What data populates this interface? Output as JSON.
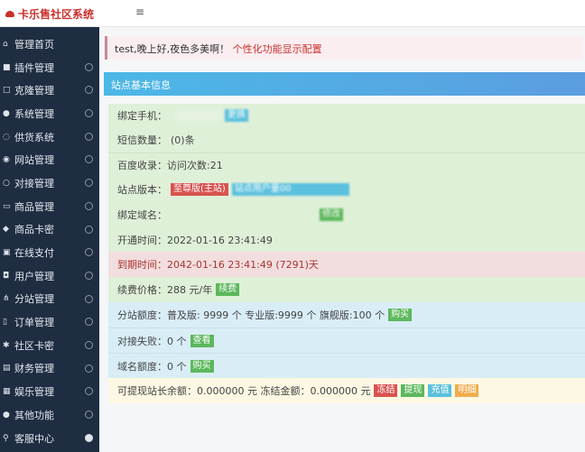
{
  "header": {
    "title": "卡乐售社区系统",
    "menu_icon": "≡"
  },
  "sidebar": {
    "items": [
      {
        "label": "管理首页",
        "icon": "home"
      },
      {
        "label": "插件管理",
        "icon": "lock"
      },
      {
        "label": "克隆管理",
        "icon": "copy"
      },
      {
        "label": "系统管理",
        "icon": "search"
      },
      {
        "label": "供货系统",
        "icon": "supply"
      },
      {
        "label": "网站管理",
        "icon": "globe"
      },
      {
        "label": "对接管理",
        "icon": "link"
      },
      {
        "label": "商品管理",
        "icon": "box"
      },
      {
        "label": "商品卡密",
        "icon": "key"
      },
      {
        "label": "在线支付",
        "icon": "pay"
      },
      {
        "label": "用户管理",
        "icon": "user"
      },
      {
        "label": "分站管理",
        "icon": "share"
      },
      {
        "label": "订单管理",
        "icon": "order"
      },
      {
        "label": "社区卡密",
        "icon": "card"
      },
      {
        "label": "财务管理",
        "icon": "finance"
      },
      {
        "label": "娱乐管理",
        "icon": "game"
      },
      {
        "label": "其他功能",
        "icon": "apple"
      },
      {
        "label": "客服中心",
        "icon": "service"
      }
    ]
  },
  "alert": {
    "greeting": "test,晚上好,夜色多美啊！",
    "link": "个性化功能显示配置"
  },
  "panel": {
    "title": "站点基本信息",
    "phone_label": "绑定手机：",
    "phone_btn": "更换",
    "sms_label": "短信数量：",
    "sms_value": "(0)条",
    "baidu_label": "百度收录：",
    "baidu_value": "访问次数:21",
    "version_label": "站点版本：",
    "version_badge": "至尊版(主站)",
    "version_info": "站点用户量00",
    "domain_label": "绑定域名：",
    "domain_btn": "修改",
    "open_label": "开通时间：",
    "open_value": "2022-01-16 23:41:49",
    "expire_label": "到期时间：",
    "expire_value": "2042-01-16 23:41:49 (7291)天",
    "price_label": "续费价格：",
    "price_value": "288 元/年",
    "price_btn": "续费",
    "quota_label": "分站额度：",
    "quota_value": "普及版: 9999 个 专业版:9999 个 旗舰版:100 个",
    "quota_btn": "购买",
    "fail_label": "对接失败：",
    "fail_value": "0 个",
    "fail_btn": "查看",
    "dquota_label": "域名额度：",
    "dquota_value": "0 个",
    "dquota_btn": "购买",
    "balance_label": "可提现站长余额：",
    "balance_value": "0.000000 元",
    "frozen_label": "冻结金额：",
    "frozen_value": "0.000000 元",
    "btn_freeze": "冻结",
    "btn_withdraw": "提现",
    "btn_recharge": "充值",
    "btn_detail": "明细"
  }
}
